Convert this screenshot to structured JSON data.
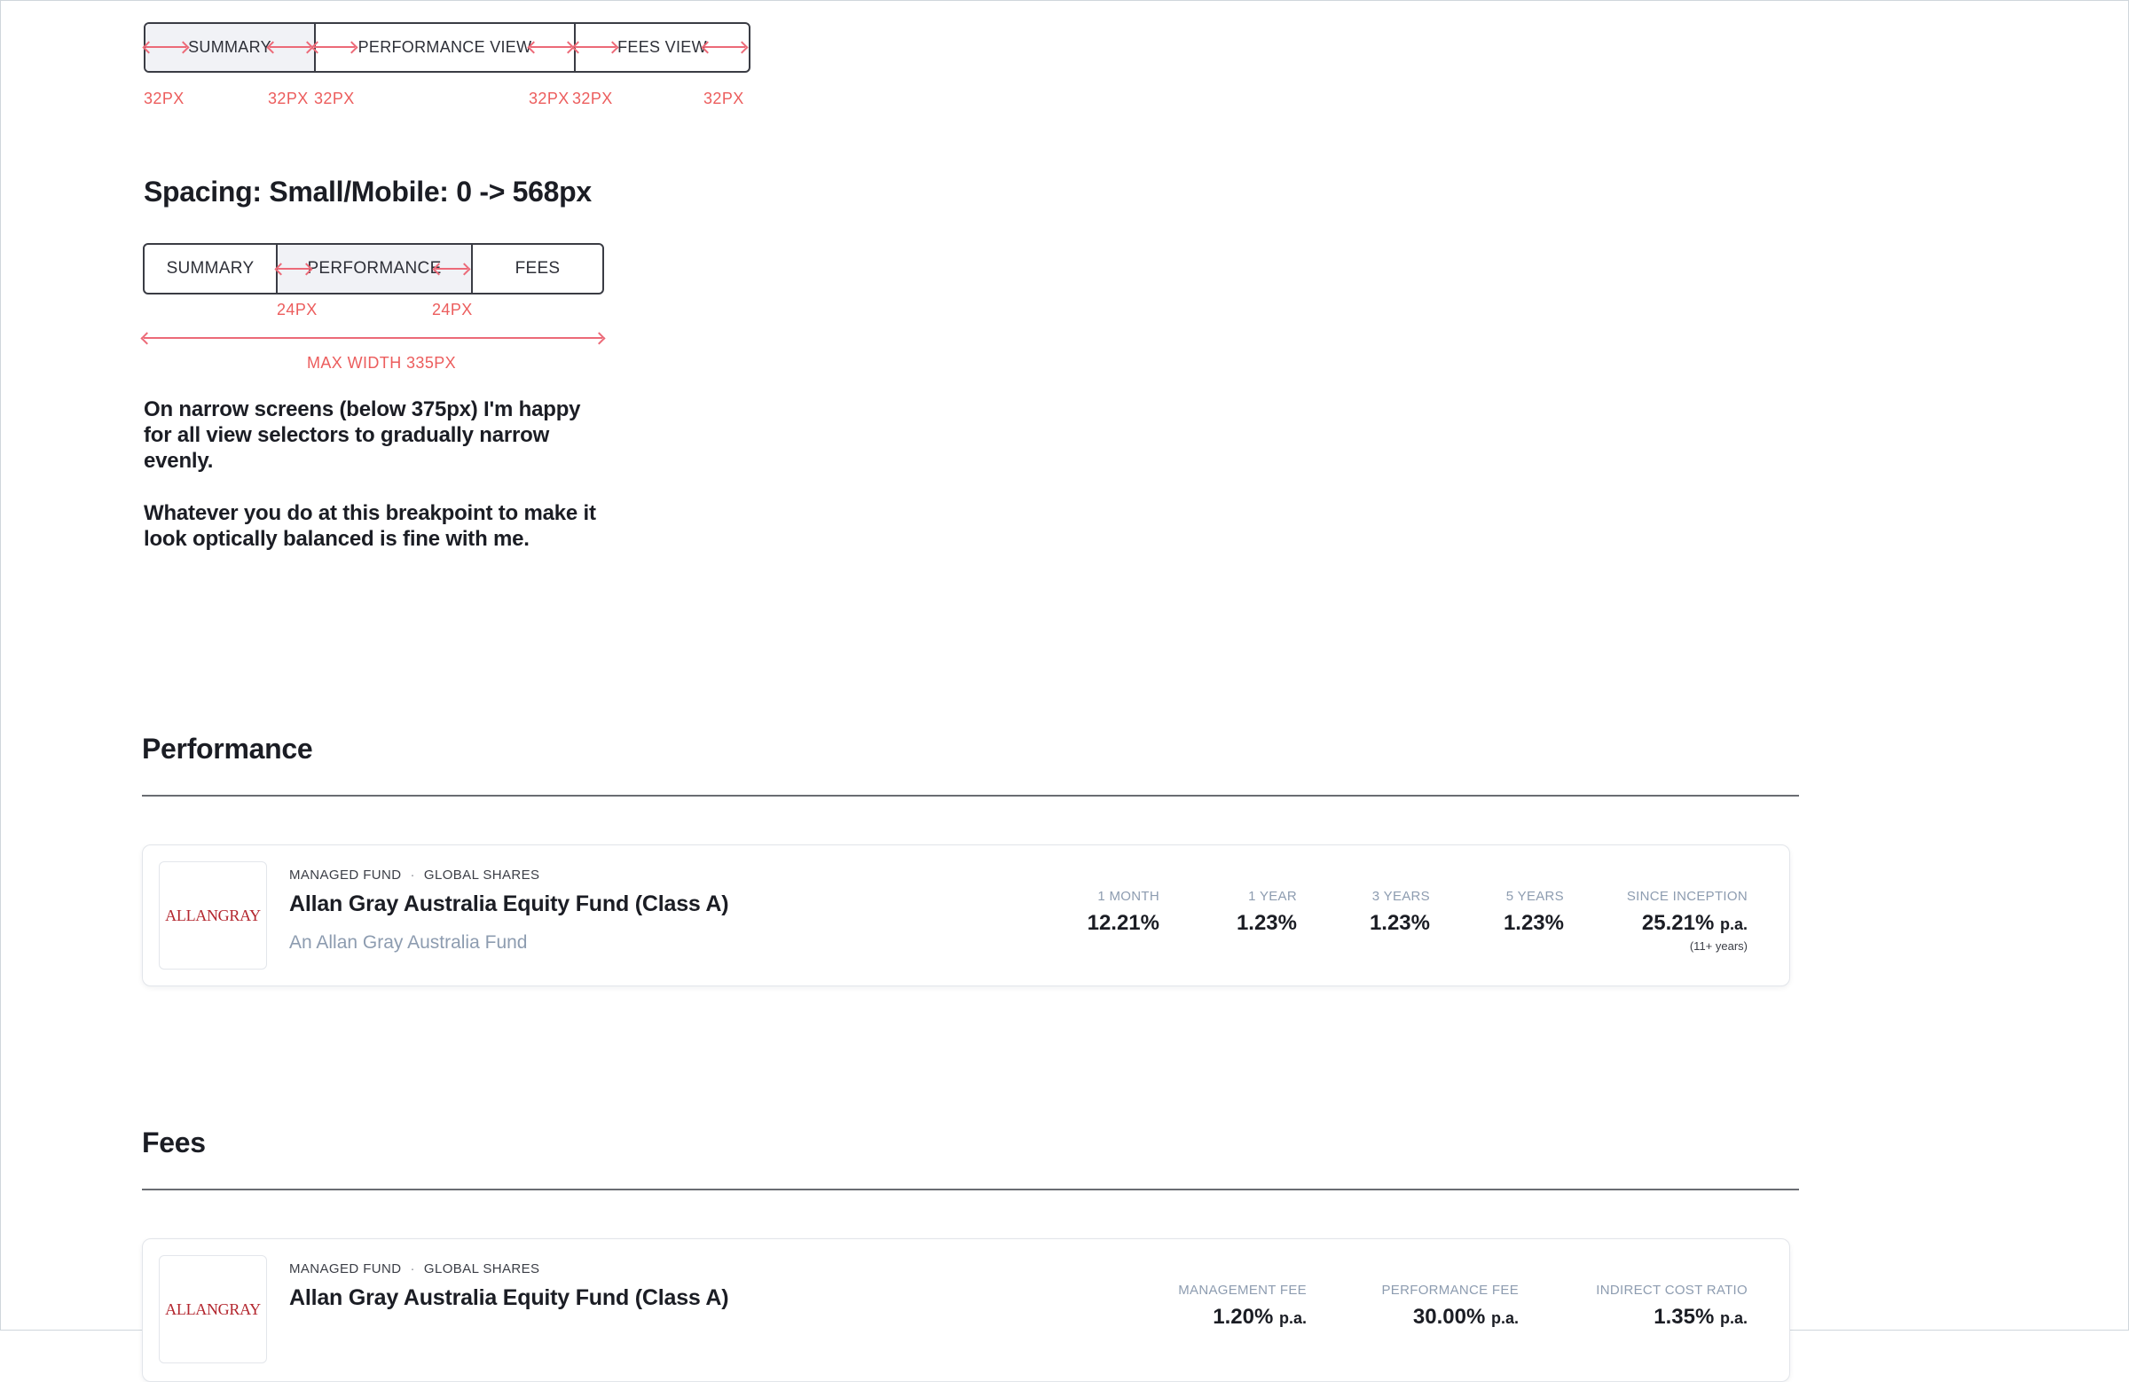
{
  "selector_large": {
    "tabs": [
      "SUMMARY",
      "PERFORMANCE VIEW",
      "FEES VIEW"
    ],
    "active_index": 0,
    "spacing_labels": [
      "32PX",
      "32PX",
      "32PX",
      "32PX",
      "32PX",
      "32PX"
    ]
  },
  "spacing_small": {
    "heading": "Spacing: Small/Mobile: 0 -> 568px",
    "tabs": [
      "SUMMARY",
      "PERFORMANCE",
      "FEES"
    ],
    "active_index": 1,
    "spacing_labels": [
      "24PX",
      "24PX"
    ],
    "max_width_label": "MAX WIDTH 335PX",
    "note_1": "On narrow screens (below 375px) I'm happy for all view selectors to gradually narrow evenly.",
    "note_2": "Whatever you do at this breakpoint to make it look optically balanced is fine with me."
  },
  "performance": {
    "title": "Performance",
    "card": {
      "logo_text": "ALLANGRAY",
      "tag_1": "MANAGED FUND",
      "tag_separator": "·",
      "tag_2": "GLOBAL SHARES",
      "name": "Allan Gray Australia Equity Fund (Class A)",
      "subtitle": "An Allan Gray Australia Fund",
      "metrics": [
        {
          "label": "1 MONTH",
          "value": "12.21%"
        },
        {
          "label": "1 YEAR",
          "value": "1.23%"
        },
        {
          "label": "3 YEARS",
          "value": "1.23%"
        },
        {
          "label": "5 YEARS",
          "value": "1.23%"
        },
        {
          "label": "SINCE INCEPTION",
          "value": "25.21%",
          "unit": "p.a.",
          "note": "(11+ years)"
        }
      ]
    }
  },
  "fees": {
    "title": "Fees",
    "card": {
      "logo_text": "ALLANGRAY",
      "tag_1": "MANAGED FUND",
      "tag_separator": "·",
      "tag_2": "GLOBAL SHARES",
      "name": "Allan Gray Australia Equity Fund (Class A)",
      "metrics": [
        {
          "label": "MANAGEMENT FEE",
          "value": "1.20%",
          "unit": "p.a."
        },
        {
          "label": "PERFORMANCE FEE",
          "value": "30.00%",
          "unit": "p.a."
        },
        {
          "label": "INDIRECT COST RATIO",
          "value": "1.35%",
          "unit": "p.a."
        }
      ]
    }
  },
  "colors": {
    "annotation": "#ec5d5d",
    "muted_text": "#8d9cb0",
    "logo_red": "#b3262e"
  }
}
